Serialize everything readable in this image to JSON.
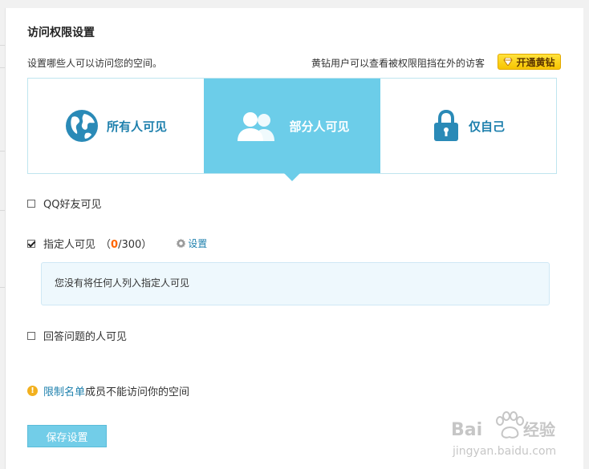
{
  "header": {
    "title": "访问权限设置",
    "desc": "设置哪些人可以访问您的空间。",
    "vip_tip": "黄钻用户可以查看被权限阻挡在外的访客",
    "vip_button": "开通黄钻"
  },
  "options": [
    {
      "label": "所有人可见",
      "icon": "globe-icon",
      "selected": false
    },
    {
      "label": "部分人可见",
      "icon": "people-icon",
      "selected": true
    },
    {
      "label": "仅自己",
      "icon": "lock-icon",
      "selected": false
    }
  ],
  "checks": {
    "qq_friends": {
      "label": "QQ好友可见",
      "checked": false
    },
    "specified": {
      "label": "指定人可见",
      "count_open": "（",
      "count_current": "0",
      "count_rest": "/300）",
      "checked": true,
      "set_label": "设置",
      "empty_text": "您没有将任何人列入指定人可见"
    },
    "answer": {
      "label": "回答问题的人可见",
      "checked": false
    }
  },
  "restrict": {
    "link": "限制名单",
    "text": "成员不能访问你的空间"
  },
  "save_button": "保存设置",
  "watermark": {
    "brand": "Bai",
    "brand_cn": "经验",
    "url": "jingyan.baidu.com"
  },
  "colors": {
    "accent": "#6ccde9",
    "link": "#1e80ad",
    "count_highlight": "#ff6600",
    "vip_yellow": "#f7c400"
  }
}
